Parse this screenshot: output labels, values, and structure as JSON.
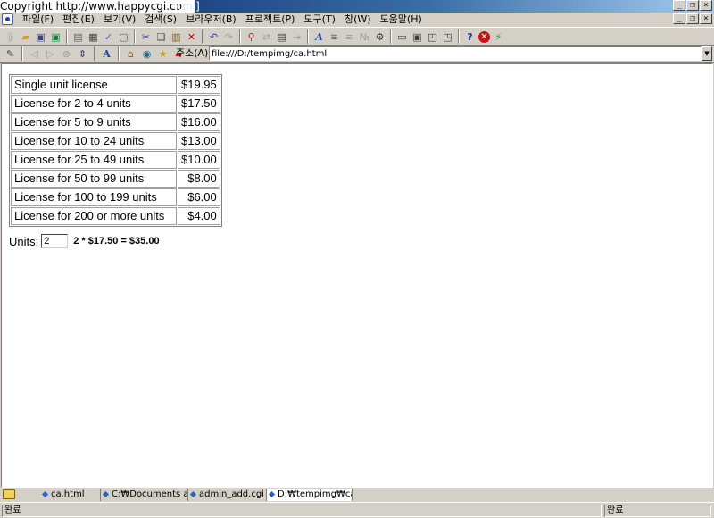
{
  "window": {
    "title": "Copyright   http://www.happycgi.com",
    "title_suffix": "itml]"
  },
  "menu": {
    "items": [
      "파일(F)",
      "편집(E)",
      "보기(V)",
      "검색(S)",
      "브라우저(B)",
      "프로젝트(P)",
      "도구(T)",
      "창(W)",
      "도움말(H)"
    ]
  },
  "address": {
    "label": "주소(A)",
    "value": "file:///D:/tempimg/ca.html"
  },
  "pricing": {
    "rows": [
      {
        "name": "Single unit license",
        "price": "$19.95"
      },
      {
        "name": "License for 2 to 4 units",
        "price": "$17.50"
      },
      {
        "name": "License for 5 to 9 units",
        "price": "$16.00"
      },
      {
        "name": "License for 10 to 24 units",
        "price": "$13.00"
      },
      {
        "name": "License for 25 to 49 units",
        "price": "$10.00"
      },
      {
        "name": "License for 50 to 99 units",
        "price": "$8.00"
      },
      {
        "name": "License for 100 to 199 units",
        "price": "$6.00"
      },
      {
        "name": "License for 200 or more units",
        "price": "$4.00"
      }
    ]
  },
  "calculator": {
    "label": "Units:",
    "value": "2",
    "result": "2 * $17.50 = $35.00"
  },
  "tabs": [
    {
      "label": "ca.html",
      "active": false
    },
    {
      "label": "C:₩Documents an",
      "active": false
    },
    {
      "label": "admin_add.cgi",
      "active": false
    },
    {
      "label": "D:₩tempimg₩ca.h",
      "active": true
    }
  ],
  "status": {
    "left": "완료",
    "right": "완료"
  }
}
